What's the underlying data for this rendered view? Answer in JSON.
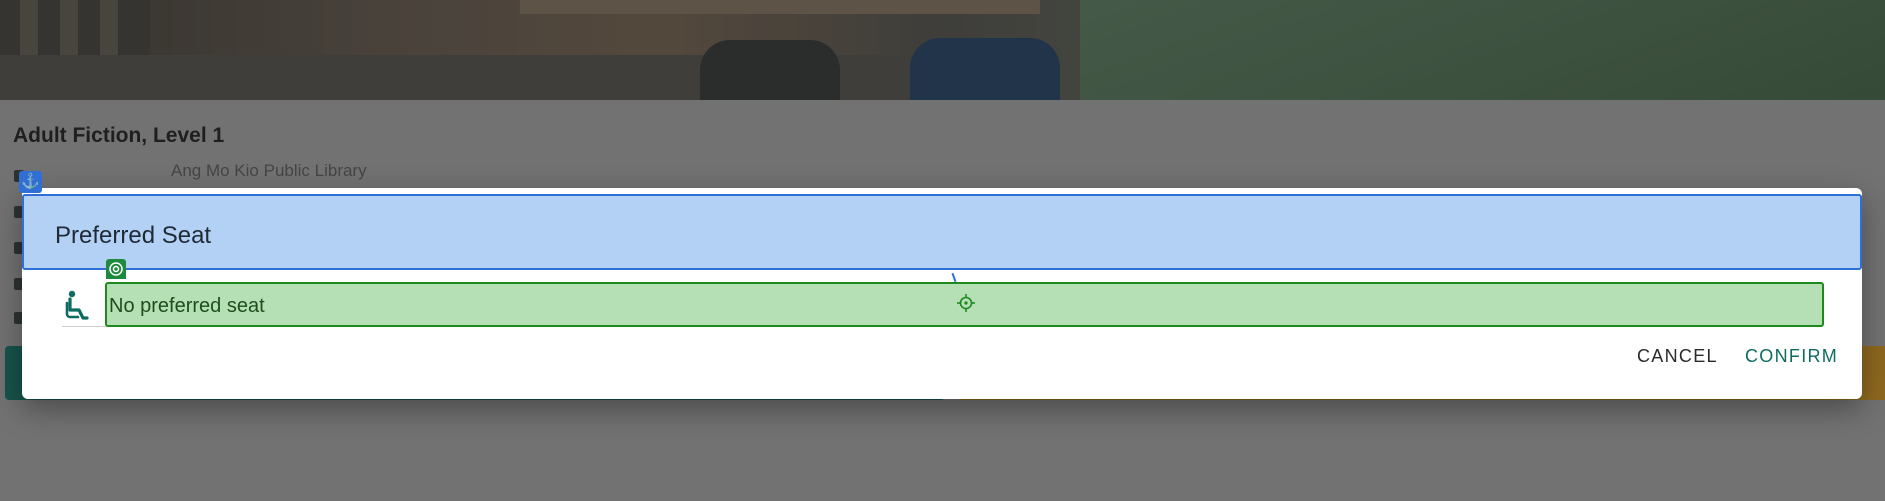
{
  "background": {
    "title": "Adult Fiction, Level 1",
    "branch": "Ang Mo Kio Public Library"
  },
  "dialog": {
    "title": "Preferred Seat",
    "seat_field": {
      "value": "No preferred seat",
      "icon": "accessible-seat-icon"
    },
    "cancel_label": "CANCEL",
    "confirm_label": "CONFIRM"
  },
  "colors": {
    "primary": "#0e6b60",
    "accent": "#c58a1c"
  }
}
